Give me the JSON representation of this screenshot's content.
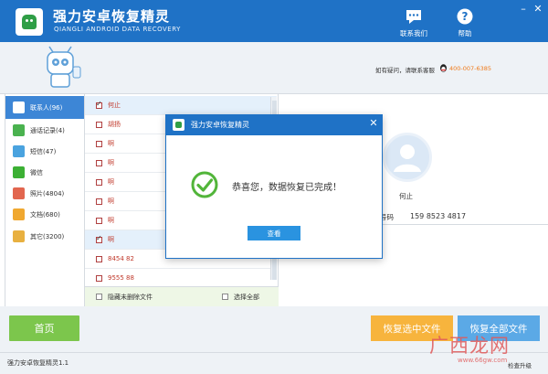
{
  "app": {
    "title": "强力安卓恢复精灵",
    "subtitle": "QIANGLI ANDROID DATA RECOVERY",
    "contact_button": "联系我们",
    "help_button": "帮助"
  },
  "header": {
    "contact_text": "如有疑问，请联系客服",
    "phone": "400-007-6385"
  },
  "sidebar": {
    "items": [
      {
        "label": "联系人(96)",
        "active": true,
        "color": "#3b7dc8"
      },
      {
        "label": "通话记录(4)",
        "active": false,
        "color": "#4ab24f"
      },
      {
        "label": "短信(47)",
        "active": false,
        "color": "#4aa3df"
      },
      {
        "label": "微信",
        "active": false,
        "color": "#3cb034"
      },
      {
        "label": "照片(4804)",
        "active": false,
        "color": "#e2664f"
      },
      {
        "label": "文档(680)",
        "active": false,
        "color": "#f0a830"
      },
      {
        "label": "其它(3200)",
        "active": false,
        "color": "#e8b040"
      }
    ]
  },
  "list": {
    "rows": [
      {
        "name": "何止",
        "checked": true
      },
      {
        "name": "胡扬",
        "checked": false
      },
      {
        "name": "啊",
        "checked": false
      },
      {
        "name": "啊",
        "checked": false
      },
      {
        "name": "啊",
        "checked": false
      },
      {
        "name": "啊",
        "checked": false
      },
      {
        "name": "啊",
        "checked": false
      },
      {
        "name": "啊",
        "checked": true
      },
      {
        "name": "8454 82",
        "checked": false
      },
      {
        "name": "9555 88",
        "checked": false
      }
    ],
    "footer_hide_deleted": "隐藏未删除文件",
    "footer_select_all": "选择全部"
  },
  "detail": {
    "name": "何止",
    "phone_label": "号码",
    "phone_value": "159 8523 4817"
  },
  "dialog": {
    "title": "强力安卓恢复精灵",
    "message": "恭喜您，数据恢复已完成！",
    "button": "查看"
  },
  "bottom": {
    "home": "首页",
    "restore_selected": "恢复选中文件",
    "restore_all": "恢复全部文件"
  },
  "status": {
    "version": "强力安卓恢复精灵1.1",
    "update": "检查升级"
  },
  "watermark": {
    "text": "广西龙网",
    "url": "www.66gw.com"
  },
  "colors": {
    "brand": "#1f72c6",
    "home_button": "#7cc64c",
    "restore_selected": "#f7b43d",
    "restore_all": "#5ba9e6"
  }
}
